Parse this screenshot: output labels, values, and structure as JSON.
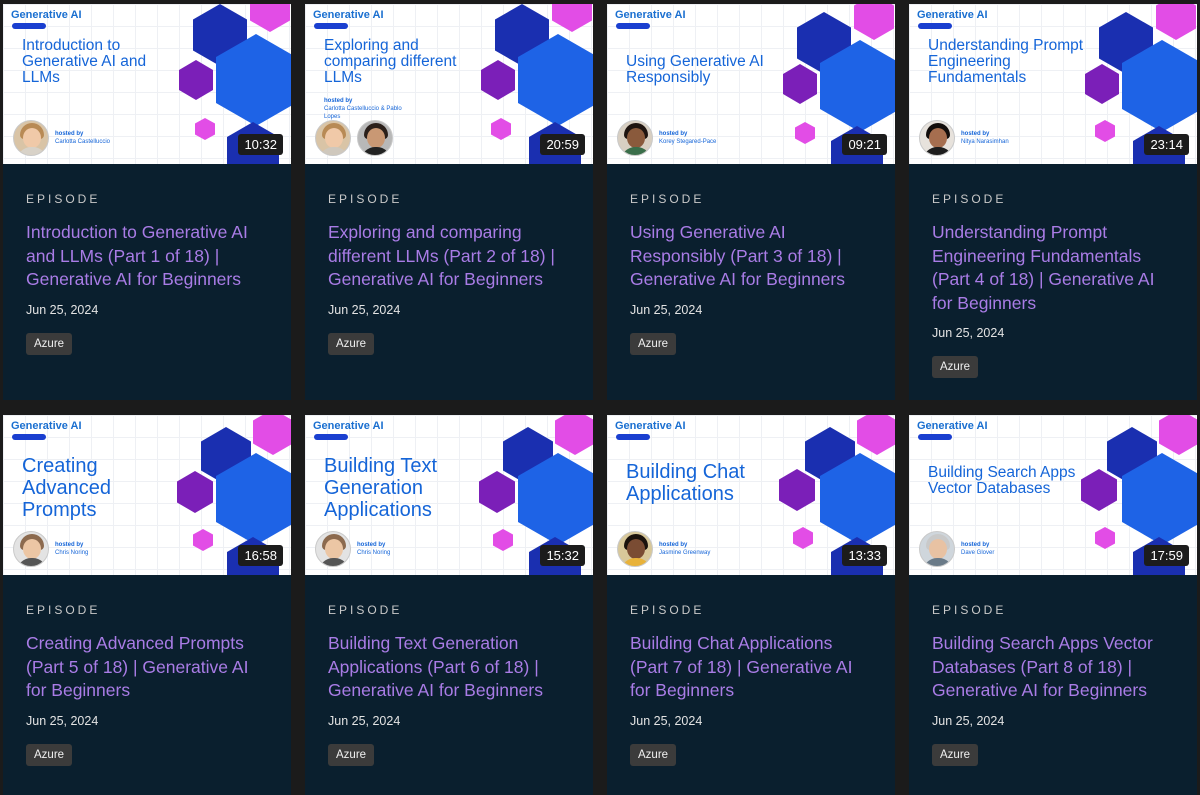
{
  "thumbnail": {
    "brand": "Generative AI",
    "hosted_label": "hosted by"
  },
  "episode_label": "EPISODE",
  "tag_label": "Azure",
  "colors": {
    "card_bg": "#0a1f2e",
    "title": "#a97ce6",
    "thumb_text": "#1565d8",
    "hex_blue": "#1e63e6",
    "hex_navy": "#1a2fb0",
    "hex_purple": "#7b1fb8",
    "hex_pink": "#e24de6"
  },
  "cards": [
    {
      "thumb_title": "Introduction to Generative AI and LLMs",
      "hosts": "Carlotta Castelluccio",
      "duration": "10:32",
      "title": "Introduction to Generative AI and LLMs (Part 1 of 18) | Generative AI for Beginners",
      "date": "Jun 25, 2024"
    },
    {
      "thumb_title": "Exploring and comparing different LLMs",
      "hosts": "Carlotta Castelluccio & Pablo Lopes",
      "duration": "20:59",
      "title": "Exploring and comparing different LLMs (Part 2 of 18) | Generative AI for Beginners",
      "date": "Jun 25, 2024"
    },
    {
      "thumb_title": "Using Generative AI Responsibly",
      "hosts": "Korey Stegared-Pace",
      "duration": "09:21",
      "title": "Using Generative AI Responsibly (Part 3 of 18) | Generative AI for Beginners",
      "date": "Jun 25, 2024"
    },
    {
      "thumb_title": "Understanding Prompt Engineering Fundamentals",
      "hosts": "Nitya Narasimhan",
      "duration": "23:14",
      "title": "Understanding Prompt Engineering Fundamentals (Part 4 of 18) | Generative AI for Beginners",
      "date": "Jun 25, 2024"
    },
    {
      "thumb_title": "Creating Advanced Prompts",
      "hosts": "Chris Noring",
      "duration": "16:58",
      "title": "Creating Advanced Prompts (Part 5 of 18) | Generative AI for Beginners",
      "date": "Jun 25, 2024"
    },
    {
      "thumb_title": "Building Text Generation Applications",
      "hosts": "Chris Noring",
      "duration": "15:32",
      "title": "Building Text Generation Applications (Part 6 of 18) | Generative AI for Beginners",
      "date": "Jun 25, 2024"
    },
    {
      "thumb_title": "Building Chat Applications",
      "hosts": "Jasmine Greenway",
      "duration": "13:33",
      "title": "Building Chat Applications (Part 7 of 18) | Generative AI for Beginners",
      "date": "Jun 25, 2024"
    },
    {
      "thumb_title": "Building Search Apps Vector Databases",
      "hosts": "Dave Glover",
      "duration": "17:59",
      "title": "Building Search Apps Vector Databases (Part 8 of 18) | Generative AI for Beginners",
      "date": "Jun 25, 2024"
    }
  ]
}
